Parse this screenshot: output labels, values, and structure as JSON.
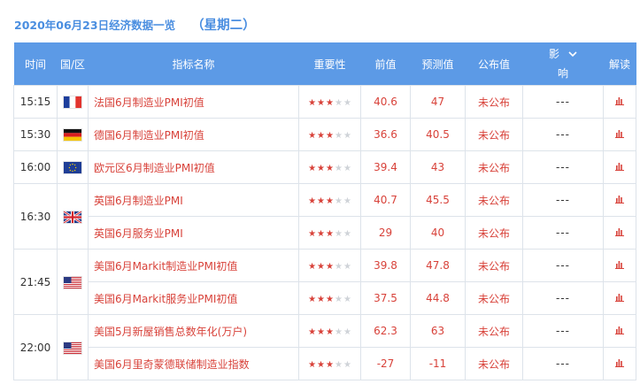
{
  "header": {
    "date_title": "2020年06月23日经济数据一览",
    "weekday": "（星期二）"
  },
  "columns": {
    "time": "时间",
    "region": "国/区",
    "indicator": "指标名称",
    "importance": "重要性",
    "previous": "前值",
    "forecast": "预测值",
    "actual": "公布值",
    "impact_1": "影",
    "impact_2": "响",
    "analysis": "解读"
  },
  "colors": {
    "header_bg": "#5c9ae6",
    "accent_red": "#d8423a",
    "title_blue": "#4a8ee0"
  },
  "rows": [
    {
      "time": "15:15",
      "flag": "france-flag",
      "name": "法国6月制造业PMI初值",
      "stars": 3,
      "previous": "40.6",
      "forecast": "47",
      "actual": "未公布",
      "impact": "---"
    },
    {
      "time": "15:30",
      "flag": "germany-flag",
      "name": "德国6月制造业PMI初值",
      "stars": 3,
      "previous": "36.6",
      "forecast": "40.5",
      "actual": "未公布",
      "impact": "---"
    },
    {
      "time": "16:00",
      "flag": "eu-flag",
      "name": "欧元区6月制造业PMI初值",
      "stars": 3,
      "previous": "39.4",
      "forecast": "43",
      "actual": "未公布",
      "impact": "---"
    },
    {
      "time": "16:30",
      "flag": "uk-flag",
      "name": "英国6月制造业PMI",
      "stars": 3,
      "previous": "40.7",
      "forecast": "45.5",
      "actual": "未公布",
      "impact": "---"
    },
    {
      "time": "",
      "flag": "",
      "name": "英国6月服务业PMI",
      "stars": 3,
      "previous": "29",
      "forecast": "40",
      "actual": "未公布",
      "impact": "---"
    },
    {
      "time": "21:45",
      "flag": "us-flag",
      "name": "美国6月Markit制造业PMI初值",
      "stars": 3,
      "previous": "39.8",
      "forecast": "47.8",
      "actual": "未公布",
      "impact": "---"
    },
    {
      "time": "",
      "flag": "",
      "name": "美国6月Markit服务业PMI初值",
      "stars": 3,
      "previous": "37.5",
      "forecast": "44.8",
      "actual": "未公布",
      "impact": "---"
    },
    {
      "time": "22:00",
      "flag": "us-flag",
      "name": "美国5月新屋销售总数年化(万户)",
      "stars": 3,
      "previous": "62.3",
      "forecast": "63",
      "actual": "未公布",
      "impact": "---"
    },
    {
      "time": "",
      "flag": "",
      "name": "美国6月里奇蒙德联储制造业指数",
      "stars": 3,
      "previous": "-27",
      "forecast": "-11",
      "actual": "未公布",
      "impact": "---"
    }
  ]
}
